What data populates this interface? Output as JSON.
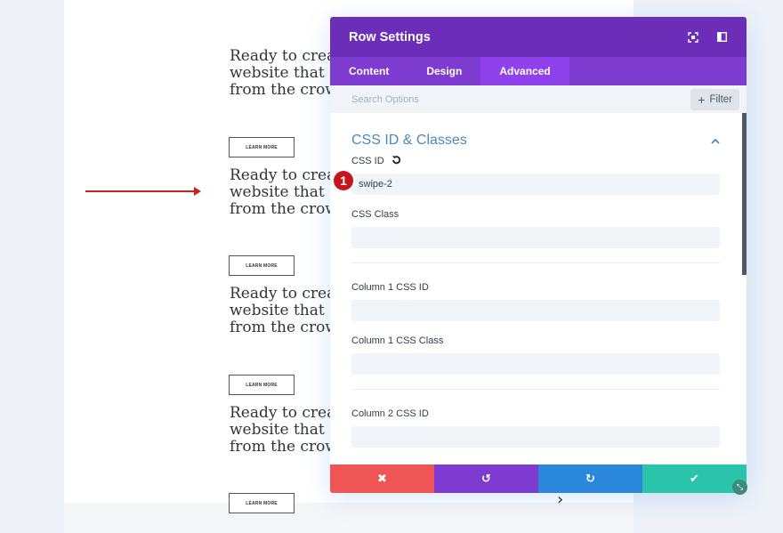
{
  "page": {
    "promo_blocks": [
      {
        "lines": [
          "Ready to creat",
          "website that st",
          "from the crow"
        ],
        "button": "LEARN MORE"
      },
      {
        "lines": [
          "Ready to creat",
          "website that st",
          "from the crow"
        ],
        "button": "LEARN MORE"
      },
      {
        "lines": [
          "Ready to creat",
          "website that st",
          "from the crow"
        ],
        "button": "LEARN MORE"
      },
      {
        "lines": [
          "Ready to creat",
          "website that st",
          "from the crow"
        ],
        "button": "LEARN MORE"
      }
    ],
    "slider_arrow": "›"
  },
  "modal": {
    "title": "Row Settings",
    "header_icons": [
      "fullscreen-icon",
      "sidebar-layout-icon"
    ],
    "tabs": [
      {
        "label": "Content",
        "active": false
      },
      {
        "label": "Design",
        "active": false
      },
      {
        "label": "Advanced",
        "active": true
      }
    ],
    "search": {
      "placeholder": "Search Options",
      "value": ""
    },
    "filter_label": "Filter",
    "filter_icon": "+",
    "section": {
      "title": "CSS ID & Classes",
      "expanded": true,
      "fields": [
        {
          "label": "CSS ID",
          "value": "swipe-2",
          "has_reset": true,
          "badge": "1"
        },
        {
          "label": "CSS Class",
          "value": ""
        },
        {
          "label": "Column 1 CSS ID",
          "value": ""
        },
        {
          "label": "Column 1 CSS Class",
          "value": ""
        },
        {
          "label": "Column 2 CSS ID",
          "value": ""
        }
      ]
    },
    "footer": {
      "cancel_icon": "✖",
      "undo_icon": "↺",
      "redo_icon": "↻",
      "save_icon": "✔",
      "colors": {
        "cancel": "#ef5555",
        "undo": "#7e3bd0",
        "redo": "#2b87da",
        "save": "#29c4a9"
      }
    }
  },
  "colors": {
    "header": "#6c2eb9",
    "tabs": "#7e3bd0",
    "active_tab": "#8f42ec",
    "section_title": "#4a88b8",
    "badge": "#c4161c",
    "annotation_arrow": "#cc1f1f"
  }
}
